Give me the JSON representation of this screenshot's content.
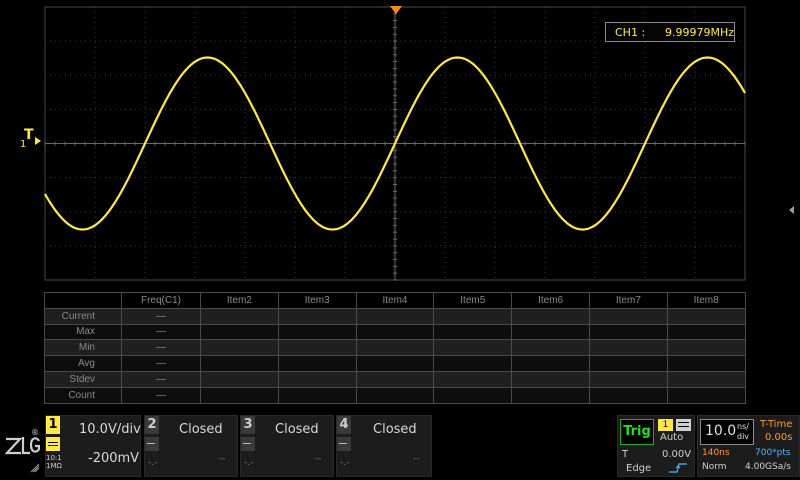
{
  "waveform": {
    "channel_color": "#ffe94a",
    "grid_color": "#3a3a3a",
    "trigger_marker": {
      "label": "T",
      "sub": "1"
    }
  },
  "freq_readout": {
    "label": "CH1 :",
    "value": "9.99979MHz"
  },
  "measure_table": {
    "headers": [
      "",
      "Freq(C1)",
      "Item2",
      "Item3",
      "Item4",
      "Item5",
      "Item6",
      "Item7",
      "Item8"
    ],
    "rows": [
      {
        "label": "Current",
        "freq": "—"
      },
      {
        "label": "Max",
        "freq": "—"
      },
      {
        "label": "Min",
        "freq": "—"
      },
      {
        "label": "Avg",
        "freq": "—"
      },
      {
        "label": "Stdev",
        "freq": "—"
      },
      {
        "label": "Count",
        "freq": "—"
      }
    ]
  },
  "branding": {
    "logo": "ZLG",
    "registered": "®",
    "impedance": "1MΩ",
    "probe": "10:1"
  },
  "channels": {
    "ch1": {
      "num": "1",
      "scale": "10.0V/div",
      "offset": "-200mV"
    },
    "ch2": {
      "num": "2",
      "status": "Closed",
      "a": "-.-",
      "b": "--"
    },
    "ch3": {
      "num": "3",
      "status": "Closed",
      "a": "-.-",
      "b": "--"
    },
    "ch4": {
      "num": "4",
      "status": "Closed",
      "a": "-.-",
      "b": "--"
    }
  },
  "trigger": {
    "button": "Trig",
    "source": "1",
    "sweep": "Auto",
    "t_label": "T",
    "level": "0.00V",
    "type": "Edge"
  },
  "timebase": {
    "value": "10.0",
    "unit_top": "ns/",
    "unit_bottom": "div",
    "mode_label": "T-Time",
    "mode_value": "0.00s",
    "mem_time": "140ns",
    "mem_points": "700*pts",
    "acq_mode": "Norm",
    "sample_rate": "4.00GSa/s"
  }
}
